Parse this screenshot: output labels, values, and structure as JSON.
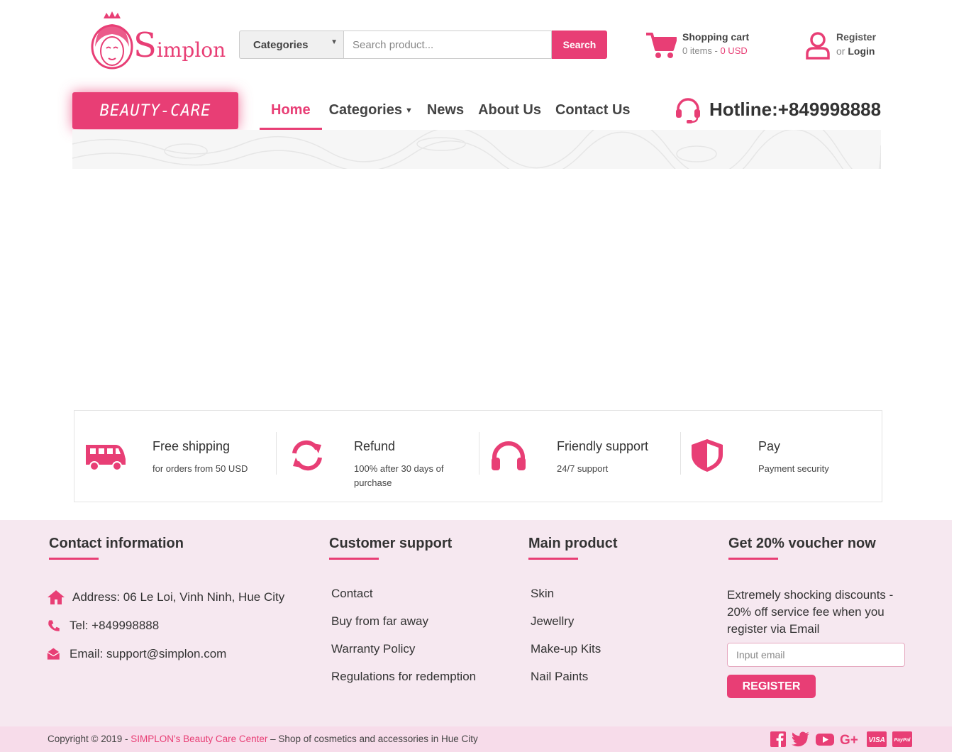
{
  "brand": {
    "name": "Simplon",
    "initial": "S",
    "rest": "implon"
  },
  "search": {
    "category_label": "Categories",
    "placeholder": "Search product...",
    "button_label": "Search"
  },
  "cart": {
    "title": "Shopping cart",
    "items": "0 items - ",
    "total": "0 USD"
  },
  "account": {
    "register": "Register",
    "or": "or ",
    "login": "Login"
  },
  "badge": "BEAUTY-CARE",
  "nav": {
    "items": [
      {
        "label": "Home"
      },
      {
        "label": "Categories"
      },
      {
        "label": "News"
      },
      {
        "label": "About Us"
      },
      {
        "label": "Contact Us"
      }
    ]
  },
  "hotline": "Hotline:+849998888",
  "features": [
    {
      "title": "Free shipping",
      "subtitle": "for orders from 50 USD",
      "icon": "truck-icon"
    },
    {
      "title": "Refund",
      "subtitle": "100% after 30 days of purchase",
      "icon": "refresh-icon"
    },
    {
      "title": "Friendly support",
      "subtitle": "24/7 support",
      "icon": "headphones-icon"
    },
    {
      "title": "Pay",
      "subtitle": "Payment security",
      "icon": "shield-icon"
    }
  ],
  "footer": {
    "contact": {
      "heading": "Contact information",
      "address": "Address: 06 Le Loi, Vinh Ninh, Hue City",
      "tel": "Tel: +849998888",
      "email": "Email: support@simplon.com"
    },
    "support": {
      "heading": "Customer support",
      "links": [
        "Contact",
        "Buy from far away",
        "Warranty Policy",
        "Regulations for redemption"
      ]
    },
    "products": {
      "heading": "Main product",
      "links": [
        "Skin",
        "Jewellry",
        "Make-up Kits",
        "Nail Paints"
      ]
    },
    "voucher": {
      "heading": "Get 20% voucher now",
      "text": "Extremely shocking discounts - 20% off service fee when you register via Email",
      "placeholder": "Input email",
      "button": "REGISTER"
    }
  },
  "copyright": {
    "prefix": "Copyright © 2019 - ",
    "highlight": "SIMPLON's Beauty Care Center",
    "suffix": " – Shop of cosmetics and accessories in Hue City"
  },
  "social": [
    "facebook-icon",
    "twitter-icon",
    "youtube-icon",
    "google-plus-icon",
    "visa-icon",
    "paypal-icon"
  ],
  "colors": {
    "accent": "#e83e75",
    "footer_bg": "#f6e8f0",
    "copyright_bg": "#f7dcea"
  }
}
